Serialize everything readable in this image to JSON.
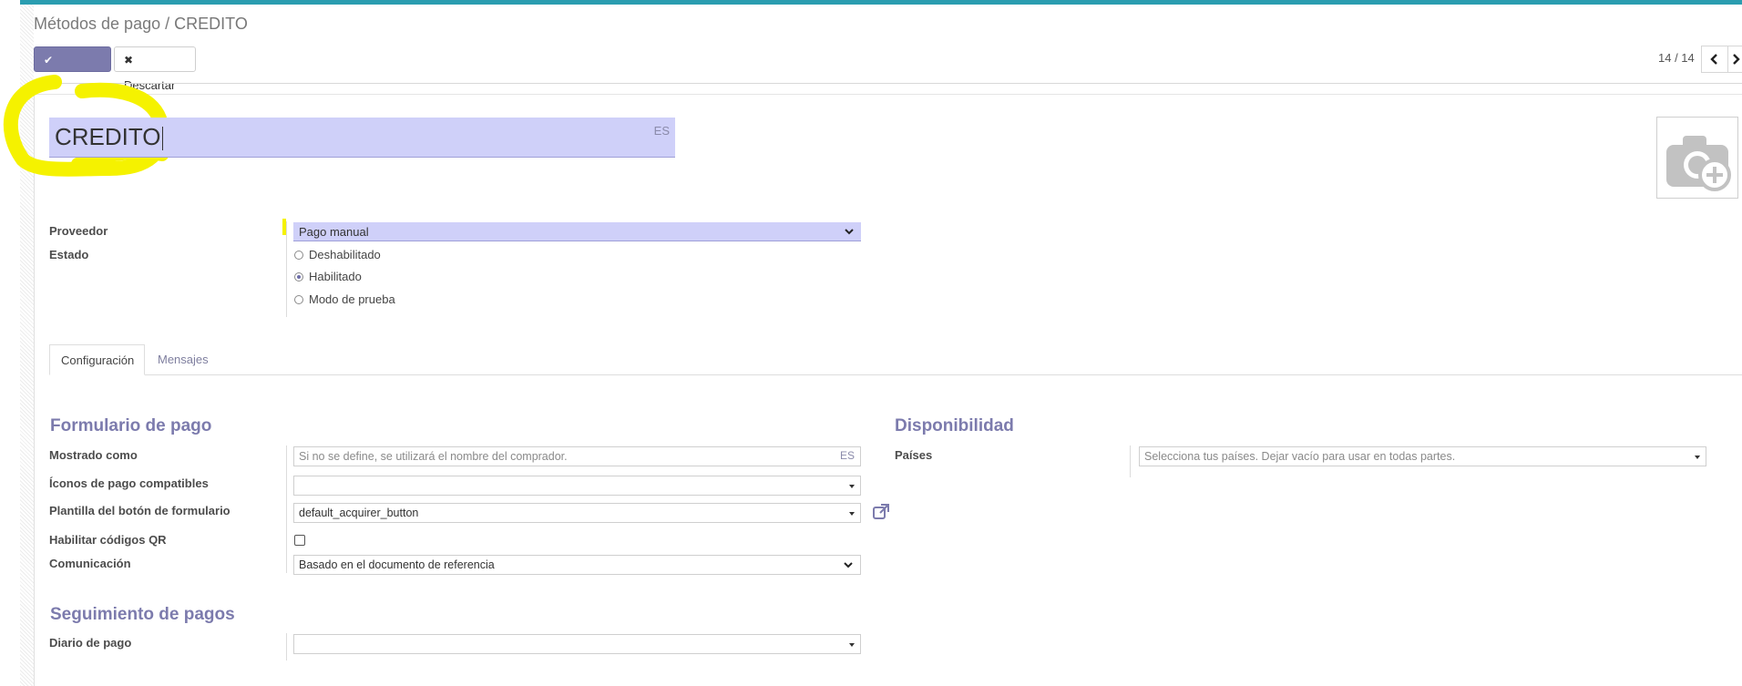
{
  "breadcrumb": {
    "parent": "Métodos de pago",
    "separator": "/",
    "current": "CREDITO"
  },
  "toolbar": {
    "save_label": "Guardar",
    "discard_label": "Descartar"
  },
  "pager": {
    "value": "14 / 14"
  },
  "record": {
    "name": "CREDITO",
    "name_lang": "ES"
  },
  "fields": {
    "provider": {
      "label": "Proveedor",
      "value": "Pago manual"
    },
    "state": {
      "label": "Estado",
      "options": [
        {
          "label": "Deshabilitado",
          "checked": false
        },
        {
          "label": "Habilitado",
          "checked": true
        },
        {
          "label": "Modo de prueba",
          "checked": false
        }
      ]
    }
  },
  "tabs": [
    {
      "label": "Configuración",
      "active": true
    },
    {
      "label": "Mensajes",
      "active": false
    }
  ],
  "payment_form": {
    "title": "Formulario de pago",
    "display_as": {
      "label": "Mostrado como",
      "placeholder": "Si no se define, se utilizará el nombre del comprador.",
      "lang": "ES"
    },
    "payment_icons": {
      "label": "Íconos de pago compatibles",
      "value": ""
    },
    "button_template": {
      "label": "Plantilla del botón de formulario",
      "value": "default_acquirer_button"
    },
    "qr_codes": {
      "label": "Habilitar códigos QR",
      "checked": false
    },
    "communication": {
      "label": "Comunicación",
      "value": "Basado en el documento de referencia"
    }
  },
  "availability": {
    "title": "Disponibilidad",
    "countries": {
      "label": "Países",
      "placeholder": "Selecciona tus países. Dejar vacío para usar en todas partes."
    }
  },
  "payment_followup": {
    "title": "Seguimiento de pagos",
    "journal": {
      "label": "Diario de pago",
      "value": ""
    }
  },
  "colors": {
    "accent": "#7c7bad",
    "topbar": "#2a9db0",
    "input_highlight": "#cfd0f9",
    "annotation_yellow": "#f5f200"
  }
}
